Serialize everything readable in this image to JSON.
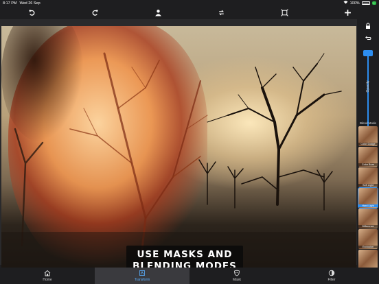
{
  "status_bar": {
    "time": "8:17 PM",
    "date": "Wed 26 Sep",
    "battery": "100%",
    "charge_tag": "+"
  },
  "toolbar": {
    "buttons": [
      {
        "name": "undo",
        "icon": "undo-icon"
      },
      {
        "name": "redo",
        "icon": "redo-icon"
      },
      {
        "name": "person",
        "icon": "person-icon"
      },
      {
        "name": "flip",
        "icon": "flip-icon"
      },
      {
        "name": "crop",
        "icon": "crop-icon"
      },
      {
        "name": "add",
        "icon": "plus-icon"
      }
    ]
  },
  "canvas": {
    "caption_line1": "USE MASKS AND",
    "caption_line2": "BLENDING MODES"
  },
  "side_panel": {
    "opacity_label": "Opacity",
    "opacity_value": 0.97,
    "blend_title": "Blend Mode",
    "blend_modes": [
      {
        "label": "Color Dodge",
        "selected": false
      },
      {
        "label": "Color Burn",
        "selected": false
      },
      {
        "label": "Soft Light",
        "selected": false
      },
      {
        "label": "Hard Light",
        "selected": true
      },
      {
        "label": "Difference",
        "selected": false
      },
      {
        "label": "Exclusion",
        "selected": false
      },
      {
        "label": "",
        "selected": false
      }
    ]
  },
  "tabbar": {
    "tabs": [
      {
        "label": "Home",
        "icon": "home-icon",
        "active": false
      },
      {
        "label": "Transform",
        "icon": "transform-icon",
        "active": true
      },
      {
        "label": "Mask",
        "icon": "mask-icon",
        "active": false
      },
      {
        "label": "Filter",
        "icon": "filter-icon",
        "active": false
      }
    ]
  },
  "colors": {
    "accent": "#2d8ef0",
    "background": "#1e1e20",
    "active_tab": "#3a3a3e"
  }
}
